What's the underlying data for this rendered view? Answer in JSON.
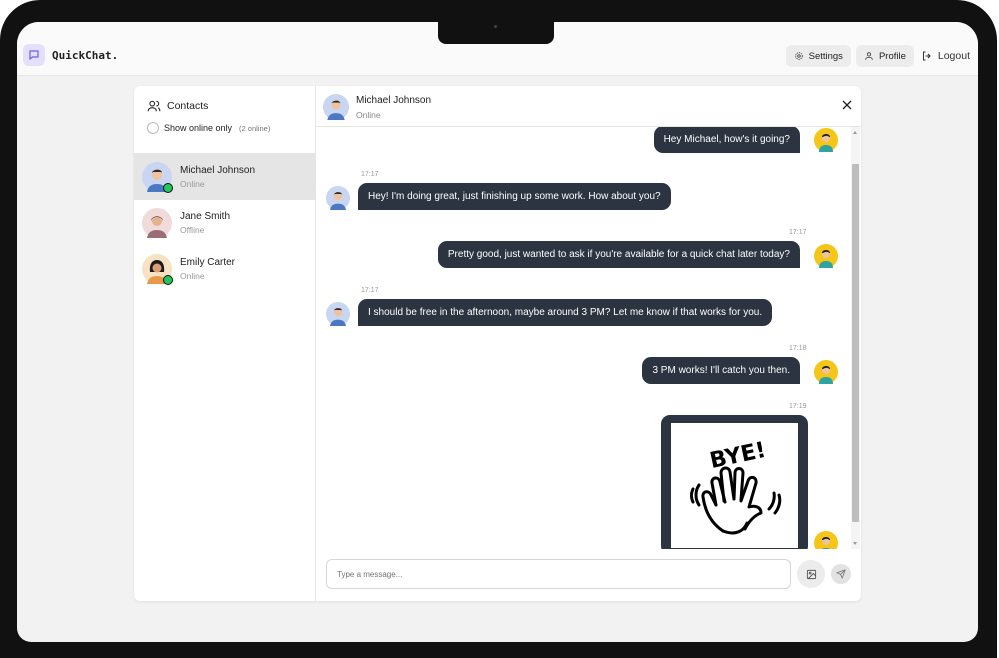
{
  "app": {
    "name": "QuickChat.",
    "brand_color": "#6d5ce8"
  },
  "nav": {
    "settings_label": "Settings",
    "profile_label": "Profile",
    "logout_label": "Logout"
  },
  "sidebar": {
    "title": "Contacts",
    "filter_label": "Show online only",
    "online_count": "(2 online)",
    "contacts": [
      {
        "name": "Michael Johnson",
        "status": "Online",
        "online": true,
        "active": true
      },
      {
        "name": "Jane Smith",
        "status": "Offline",
        "online": false,
        "active": false
      },
      {
        "name": "Emily Carter",
        "status": "Online",
        "online": true,
        "active": false
      }
    ]
  },
  "chat": {
    "contact_name": "Michael Johnson",
    "contact_status": "Online",
    "messages": [
      {
        "from": "me",
        "text": "Hey Michael, how's it going?"
      },
      {
        "from": "them",
        "time": "17:17",
        "text": "Hey! I'm doing great, just finishing up some work. How about you?"
      },
      {
        "from": "me",
        "time": "17:17",
        "text": "Pretty good, just wanted to ask if you're available for a quick chat later today?"
      },
      {
        "from": "them",
        "time": "17:17",
        "text": "I should be free in the afternoon, maybe around 3 PM? Let me know if that works for you."
      },
      {
        "from": "me",
        "time": "17:18",
        "text": "3 PM works! I'll catch you then."
      },
      {
        "from": "me",
        "time": "17:19",
        "sticker_text": "BYE!",
        "type": "sticker"
      }
    ],
    "input_placeholder": "Type a message..."
  },
  "colors": {
    "bubble": "#2b3440",
    "online": "#22c55e",
    "user_avatar_bg": "#f5c518",
    "contact_avatar_bg": "#c9d6f2"
  }
}
